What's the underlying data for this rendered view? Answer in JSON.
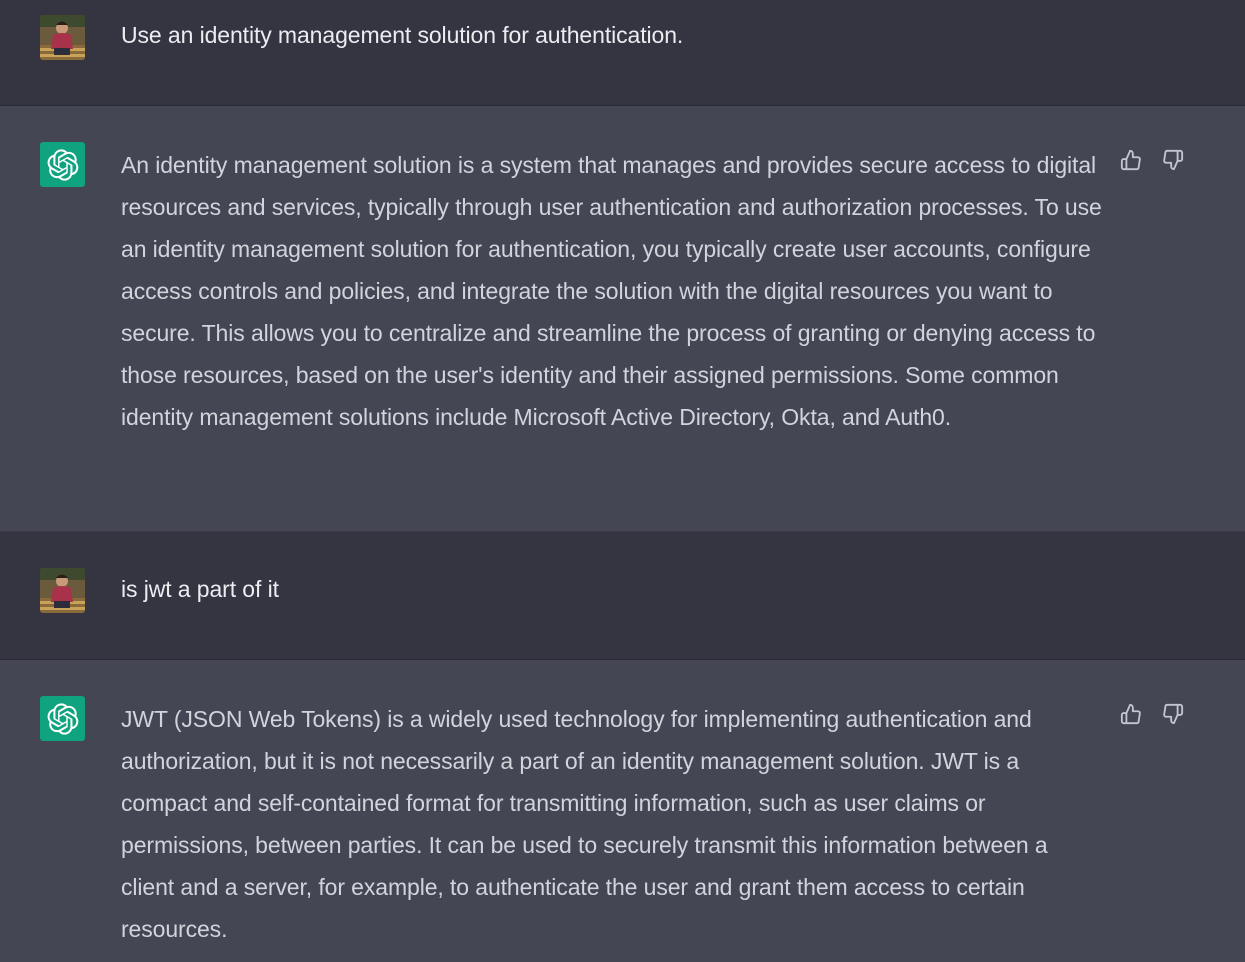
{
  "messages": [
    {
      "role": "user",
      "text": "Use an identity management solution for authentication."
    },
    {
      "role": "assistant",
      "text": "An identity management solution is a system that manages and provides secure access to digital resources and services, typically through user authentication and authorization processes. To use an identity management solution for authentication, you typically create user accounts, configure access controls and policies, and integrate the solution with the digital resources you want to secure. This allows you to centralize and streamline the process of granting or denying access to those resources, based on the user's identity and their assigned permissions. Some common identity management solutions include Microsoft Active Directory, Okta, and Auth0."
    },
    {
      "role": "user",
      "text": "is jwt a part of it"
    },
    {
      "role": "assistant",
      "text": "JWT (JSON Web Tokens) is a widely used technology for implementing authentication and authorization, but it is not necessarily a part of an identity management solution. JWT is a compact and self-contained format for transmitting information, such as user claims or permissions, between parties. It can be used to securely transmit this information between a client and a server, for example, to authenticate the user and grant them access to certain resources."
    }
  ],
  "icons": {
    "assistant_avatar": "openai-logo-icon",
    "thumbs_up": "thumbs-up-icon",
    "thumbs_down": "thumbs-down-icon"
  },
  "colors": {
    "user_bg": "#343541",
    "assistant_bg": "#444654",
    "assistant_avatar_bg": "#10a37f"
  }
}
